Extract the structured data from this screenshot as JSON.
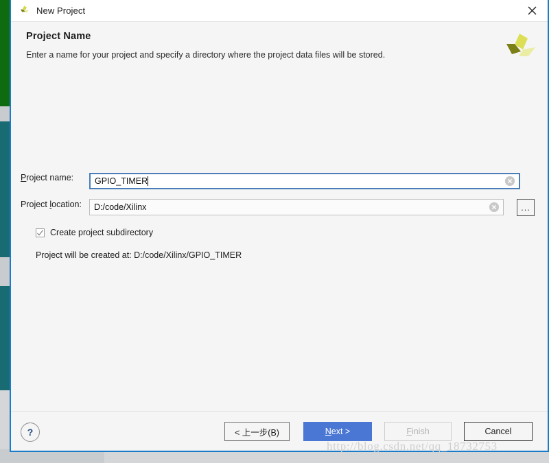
{
  "window": {
    "title": "New Project",
    "app_icon": "xilinx-logo-icon",
    "close_label": "close-icon"
  },
  "header": {
    "title": "Project Name",
    "subtitle": "Enter a name for your project and specify a directory where the project data files will be stored.",
    "brand_icon": "xilinx-vivado-logo"
  },
  "form": {
    "project_name": {
      "label_prefix": "P",
      "label_rest": "roject name:",
      "value": "GPIO_TIMER",
      "clear_icon": "clear-circle-icon"
    },
    "project_location": {
      "label_pre": "Project ",
      "label_mnemonic": "l",
      "label_post": "ocation:",
      "value": "D:/code/Xilinx",
      "clear_icon": "clear-circle-icon"
    },
    "browse_button": "...",
    "create_subdirectory": {
      "label": "Create project subdirectory",
      "checked": true
    },
    "created_at_text": "Project will be created at: D:/code/Xilinx/GPIO_TIMER"
  },
  "footer": {
    "help": "?",
    "back": "< 上一步(B)",
    "back_mnemonic": "B",
    "next_pre": "N",
    "next_post": "ext >",
    "finish_pre": "F",
    "finish_post": "inish",
    "cancel": "Cancel"
  },
  "watermark": "http://blog.csdn.net/qq_18732753",
  "colors": {
    "dialog_border": "#1a7bc9",
    "next_button": "#4a77d4",
    "focus_border": "#4a7ebb",
    "bg_green": "#0f6b10",
    "bg_teal": "#186a73",
    "logo_yellow": "#d6d84a",
    "logo_olive": "#7c7f15"
  }
}
